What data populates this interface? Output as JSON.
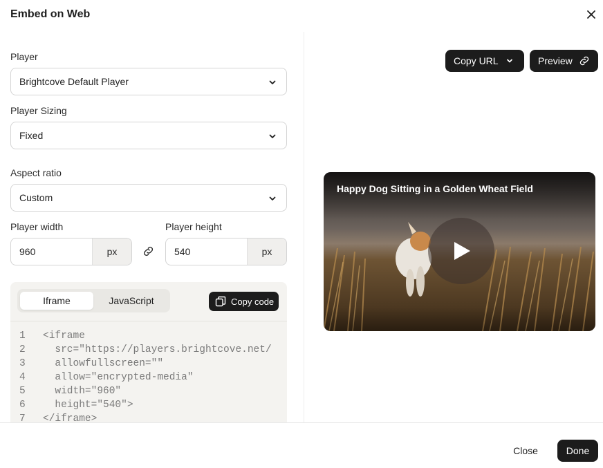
{
  "dialog": {
    "title": "Embed on Web",
    "close_icon": "close-icon"
  },
  "form": {
    "player": {
      "label": "Player",
      "value": "Brightcove Default Player"
    },
    "player_sizing": {
      "label": "Player Sizing",
      "value": "Fixed"
    },
    "aspect_ratio": {
      "label": "Aspect ratio",
      "value": "Custom"
    },
    "player_width": {
      "label": "Player width",
      "value": "960",
      "unit": "px"
    },
    "player_height": {
      "label": "Player height",
      "value": "540",
      "unit": "px"
    }
  },
  "code_panel": {
    "tabs": [
      {
        "label": "Iframe",
        "active": true
      },
      {
        "label": "JavaScript",
        "active": false
      }
    ],
    "copy_code_label": "Copy code",
    "lines": [
      {
        "num": "1",
        "text": "<iframe"
      },
      {
        "num": "2",
        "text": "  src=\"https://players.brightcove.net/"
      },
      {
        "num": "3",
        "text": "  allowfullscreen=\"\""
      },
      {
        "num": "4",
        "text": "  allow=\"encrypted-media\""
      },
      {
        "num": "5",
        "text": "  width=\"960\""
      },
      {
        "num": "6",
        "text": "  height=\"540\">"
      },
      {
        "num": "7",
        "text": "</iframe>"
      }
    ]
  },
  "preview_area": {
    "copy_url_label": "Copy URL",
    "preview_label": "Preview",
    "video_title": "Happy Dog Sitting in a Golden Wheat Field"
  },
  "footer": {
    "close_label": "Close",
    "done_label": "Done"
  },
  "colors": {
    "dark_button": "#1c1c1c",
    "border": "#d4d4d4",
    "code_bg": "#f4f3f0"
  }
}
